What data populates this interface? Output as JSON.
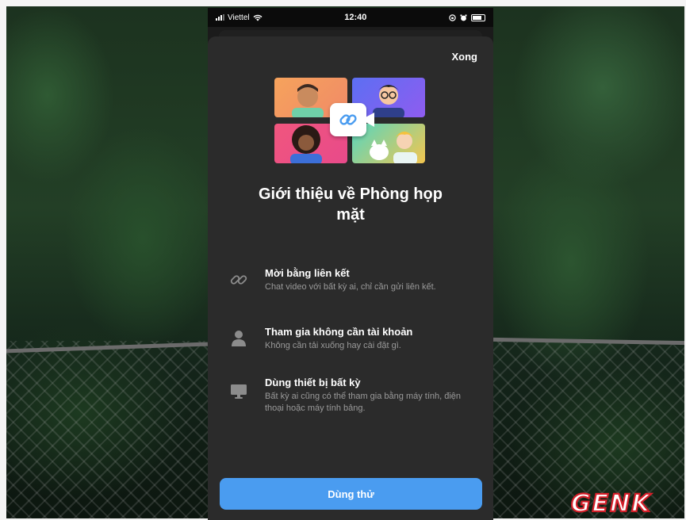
{
  "status_bar": {
    "carrier": "Viettel",
    "time": "12:40"
  },
  "sheet": {
    "done_label": "Xong",
    "title": "Giới thiệu về Phòng họp mặt",
    "features": [
      {
        "icon": "link-icon",
        "title": "Mời bằng liên kết",
        "description": "Chat video với bất kỳ ai, chỉ cần gửi liên kết."
      },
      {
        "icon": "person-icon",
        "title": "Tham gia không cần tài khoản",
        "description": "Không cần tải xuống hay cài đặt gì."
      },
      {
        "icon": "monitor-icon",
        "title": "Dùng thiết bị bất kỳ",
        "description": "Bất kỳ ai cũng có thể tham gia bằng máy tính, điện thoại hoặc máy tính bảng."
      }
    ],
    "cta_label": "Dùng thử"
  },
  "watermark": {
    "text": "GENK"
  },
  "colors": {
    "accent": "#4a9cf0",
    "sheet_bg": "#2b2b2b"
  }
}
